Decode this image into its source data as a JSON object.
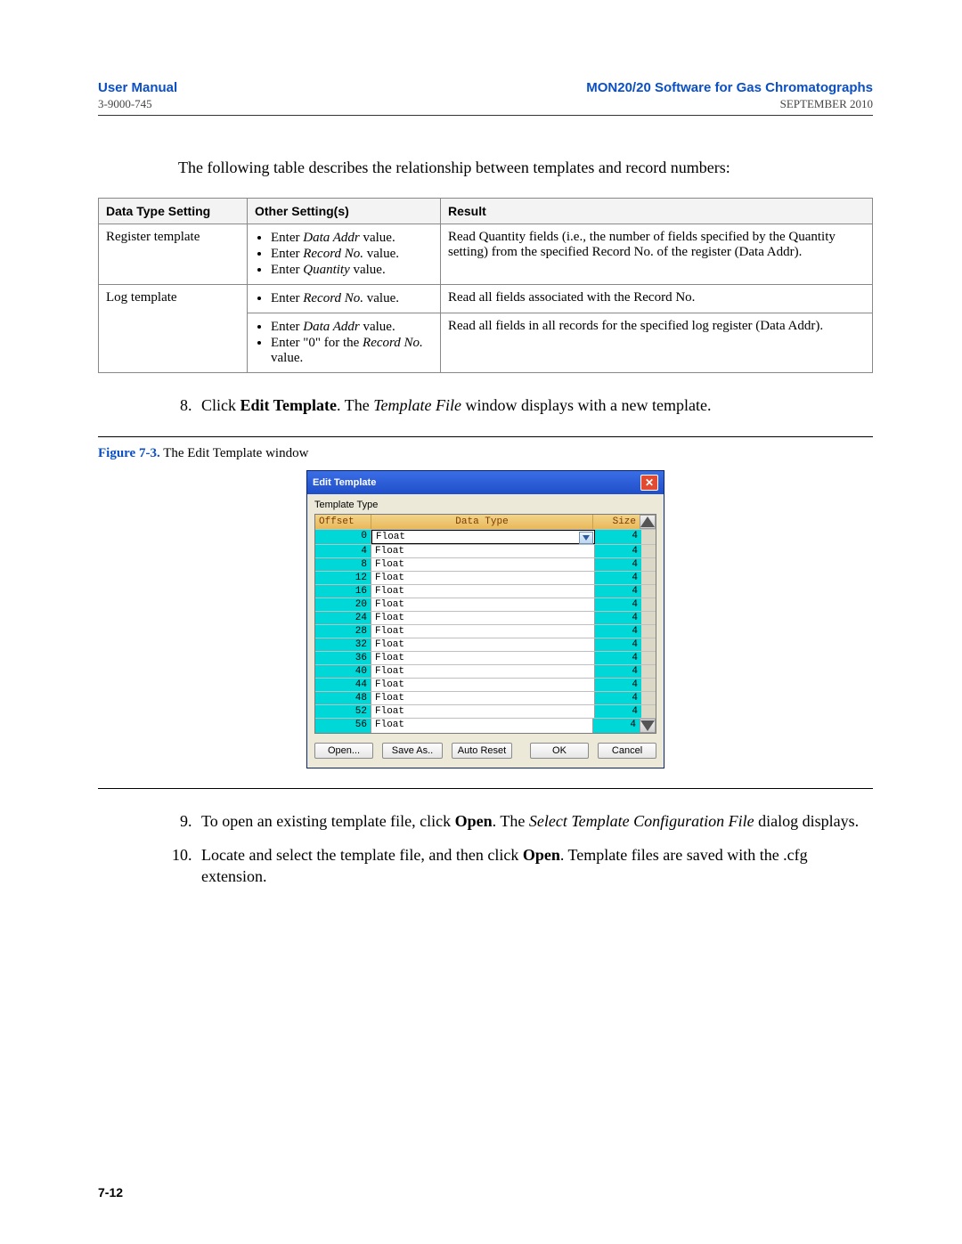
{
  "header": {
    "left_title": "User Manual",
    "right_title": "MON20/20 Software for Gas Chromatographs",
    "left_sub": "3-9000-745",
    "right_sub": "SEPTEMBER 2010"
  },
  "intro": "The following table describes the relationship between templates and record numbers:",
  "table": {
    "headers": {
      "c1": "Data Type Setting",
      "c2": "Other Setting(s)",
      "c3": "Result"
    },
    "rows": [
      {
        "c1": "Register template",
        "bullets": [
          {
            "pre": "Enter ",
            "ital": "Data Addr",
            "post": " value."
          },
          {
            "pre": "Enter ",
            "ital": "Record No.",
            "post": " value."
          },
          {
            "pre": "Enter ",
            "ital": "Quantity",
            "post": " value."
          }
        ],
        "c3": "Read Quantity fields (i.e., the number of fields specified by the Quantity setting) from the specified Record No. of the register (Data Addr)."
      },
      {
        "c1": "Log template",
        "bullets": [
          {
            "pre": "Enter ",
            "ital": "Record No.",
            "post": " value."
          }
        ],
        "c3": "Read all fields associated with the Record No."
      },
      {
        "c1": "",
        "bullets": [
          {
            "pre": "Enter ",
            "ital": "Data Addr",
            "post": " value."
          },
          {
            "pre": "Enter \"0\" for the ",
            "ital": "Record No.",
            "post": " value."
          }
        ],
        "c3": "Read all fields in all records for the specified log register (Data Addr)."
      }
    ]
  },
  "step8": {
    "pre": "Click ",
    "bold": "Edit Template",
    "mid": ". The ",
    "ital": "Template File",
    "post": " window displays with a new template."
  },
  "figure": {
    "label": "Figure 7-3.",
    "caption": "  The Edit Template window"
  },
  "dialog": {
    "title": "Edit Template",
    "template_type_label": "Template Type",
    "grid_headers": {
      "offset": "Offset",
      "data_type": "Data Type",
      "size": "Size"
    },
    "rows": [
      {
        "offset": "0",
        "type": "Float",
        "size": "4"
      },
      {
        "offset": "4",
        "type": "Float",
        "size": "4"
      },
      {
        "offset": "8",
        "type": "Float",
        "size": "4"
      },
      {
        "offset": "12",
        "type": "Float",
        "size": "4"
      },
      {
        "offset": "16",
        "type": "Float",
        "size": "4"
      },
      {
        "offset": "20",
        "type": "Float",
        "size": "4"
      },
      {
        "offset": "24",
        "type": "Float",
        "size": "4"
      },
      {
        "offset": "28",
        "type": "Float",
        "size": "4"
      },
      {
        "offset": "32",
        "type": "Float",
        "size": "4"
      },
      {
        "offset": "36",
        "type": "Float",
        "size": "4"
      },
      {
        "offset": "40",
        "type": "Float",
        "size": "4"
      },
      {
        "offset": "44",
        "type": "Float",
        "size": "4"
      },
      {
        "offset": "48",
        "type": "Float",
        "size": "4"
      },
      {
        "offset": "52",
        "type": "Float",
        "size": "4"
      },
      {
        "offset": "56",
        "type": "Float",
        "size": "4"
      }
    ],
    "buttons": {
      "open": "Open...",
      "save_as": "Save As..",
      "auto_reset": "Auto Reset",
      "ok": "OK",
      "cancel": "Cancel"
    }
  },
  "step9": {
    "pre": "To open an existing template file, click ",
    "bold": "Open",
    "mid": ". The ",
    "ital": "Select Template Configuration File",
    "post": " dialog displays."
  },
  "step10": {
    "pre": "Locate and select the template file, and then click ",
    "bold": "Open",
    "post": ".  Template files are saved with the .cfg extension."
  },
  "page_number": "7-12"
}
